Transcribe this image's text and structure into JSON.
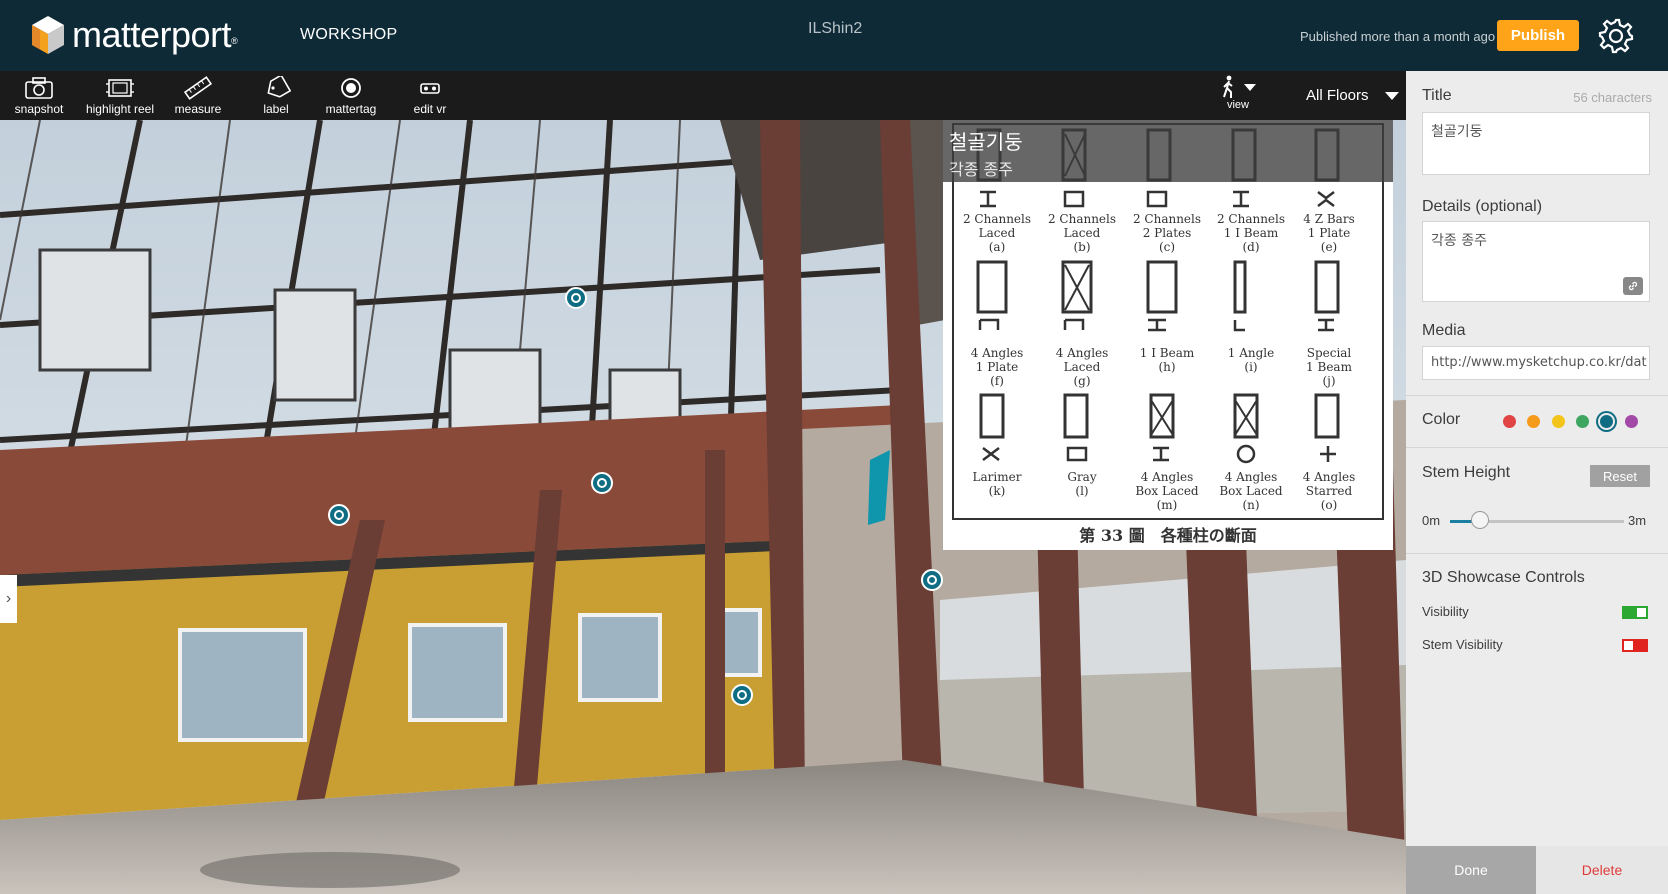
{
  "header": {
    "logo_text": "matterport",
    "logo_reg": "®",
    "product": "WORKSHOP",
    "model_name": "ILShin2",
    "status": "Published more than a month ago",
    "publish_label": "Publish"
  },
  "toolbar": {
    "tools": [
      {
        "label": "snapshot",
        "icon": "camera-icon"
      },
      {
        "label": "highlight reel",
        "icon": "film-icon"
      },
      {
        "label": "measure",
        "icon": "ruler-icon"
      },
      {
        "label": "label",
        "icon": "tag-icon"
      },
      {
        "label": "mattertag",
        "icon": "mattertag-icon"
      },
      {
        "label": "edit vr",
        "icon": "vr-goggles-icon"
      }
    ],
    "view_label": "view",
    "floors_label": "All Floors"
  },
  "popup": {
    "title": "철골기둥",
    "subtitle": "각종 종주",
    "caption": "第 33 圖　各種柱の斷面",
    "cells": [
      {
        "l1": "2 Channels",
        "l2": "Laced",
        "l3": "(a)"
      },
      {
        "l1": "2 Channels",
        "l2": "Laced",
        "l3": "(b)"
      },
      {
        "l1": "2 Channels",
        "l2": "2 Plates",
        "l3": "(c)"
      },
      {
        "l1": "2 Channels",
        "l2": "1 I Beam",
        "l3": "(d)"
      },
      {
        "l1": "4 Z Bars",
        "l2": "1 Plate",
        "l3": "(e)"
      },
      {
        "l1": "4 Angles",
        "l2": "1 Plate",
        "l3": "(f)"
      },
      {
        "l1": "4 Angles",
        "l2": "Laced",
        "l3": "(g)"
      },
      {
        "l1": "1 I Beam",
        "l2": "(h)",
        "l3": ""
      },
      {
        "l1": "1 Angle",
        "l2": "(i)",
        "l3": ""
      },
      {
        "l1": "Special",
        "l2": "1 Beam",
        "l3": "(j)"
      },
      {
        "l1": "Larimer",
        "l2": "(k)",
        "l3": ""
      },
      {
        "l1": "Gray",
        "l2": "(l)",
        "l3": ""
      },
      {
        "l1": "4 Angles",
        "l2": "Box Laced",
        "l3": "(m)"
      },
      {
        "l1": "4 Angles",
        "l2": "Box Laced",
        "l3": "(n)"
      },
      {
        "l1": "4 Angles",
        "l2": "Starred",
        "l3": "(o)"
      }
    ]
  },
  "panel": {
    "title_label": "Title",
    "title_chars": "56 characters",
    "title_value": "철골기둥",
    "details_label": "Details (optional)",
    "details_value": "각종 종주",
    "media_label": "Media",
    "media_value": "http://www.mysketchup.co.kr/dat",
    "color_label": "Color",
    "colors": [
      "#e04444",
      "#f59a1b",
      "#f3c41a",
      "#3ea660",
      "#0f6d83",
      "#a34aa8"
    ],
    "selected_color": "#0f6d83",
    "stem_height_label": "Stem Height",
    "reset_label": "Reset",
    "stem_min": "0m",
    "stem_max": "3m",
    "stem_fraction": 0.17,
    "controls_title": "3D Showcase Controls",
    "visibility_label": "Visibility",
    "visibility_on": true,
    "stem_visibility_label": "Stem Visibility",
    "stem_visibility_on": false,
    "done_label": "Done",
    "delete_label": "Delete"
  }
}
